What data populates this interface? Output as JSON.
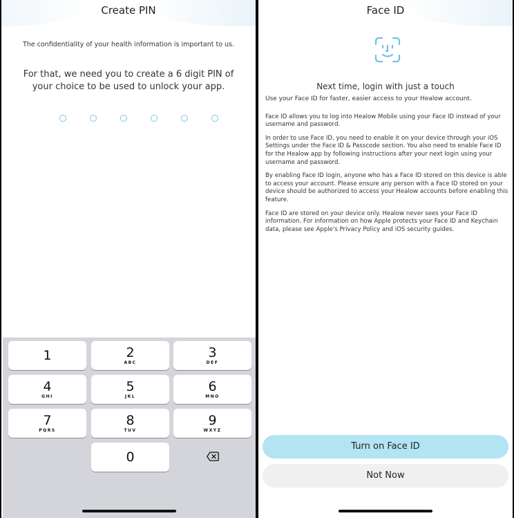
{
  "left_screen": {
    "title": "Create PIN",
    "intro_small": "The confidentiality of your health information is important to us.",
    "intro_large": "For that, we need you to create a 6 digit PIN of your choice to be used to unlock your app.",
    "pin_length": 6,
    "keypad": {
      "keys": [
        {
          "digit": "1",
          "letters": ""
        },
        {
          "digit": "2",
          "letters": "ABC"
        },
        {
          "digit": "3",
          "letters": "DEF"
        },
        {
          "digit": "4",
          "letters": "GHI"
        },
        {
          "digit": "5",
          "letters": "JKL"
        },
        {
          "digit": "6",
          "letters": "MNO"
        },
        {
          "digit": "7",
          "letters": "PQRS"
        },
        {
          "digit": "8",
          "letters": "TUV"
        },
        {
          "digit": "9",
          "letters": "WXYZ"
        },
        {
          "digit": "0",
          "letters": ""
        }
      ],
      "backspace_icon": "delete-left-icon"
    }
  },
  "right_screen": {
    "title": "Face ID",
    "face_icon": "face-id-icon",
    "headline": "Next time, login with just a touch",
    "paragraphs": [
      "Use your Face ID for faster, easier access to your Healow account.",
      "Face ID allows you to log into Healow Mobile using your Face ID instead of your username and password.",
      "In order to use Face ID, you need to enable it on your device through your iOS Settings under the Face ID & Passcode section. You also need to enable Face ID for the Healow app by following instructions after your next login using your username and password.",
      "By enabling Face ID login, anyone who has a Face ID stored on this device is able to access your account. Please ensure any person with a Face ID stored on your device should be authorized to access your Healow accounts before enabling this feature.",
      "Face ID are stored on your device only. Healow never sees your Face ID information. For information on how Apple protects your Face ID and Keychain data, please see Apple's Privacy Policy and iOS security guides."
    ],
    "primary_button": "Turn on Face ID",
    "secondary_button": "Not Now"
  },
  "colors": {
    "accent": "#7cc7e3",
    "primary_button_bg": "#b3e4f3",
    "secondary_button_bg": "#f0f0f0",
    "keypad_bg": "#d3d5da"
  }
}
